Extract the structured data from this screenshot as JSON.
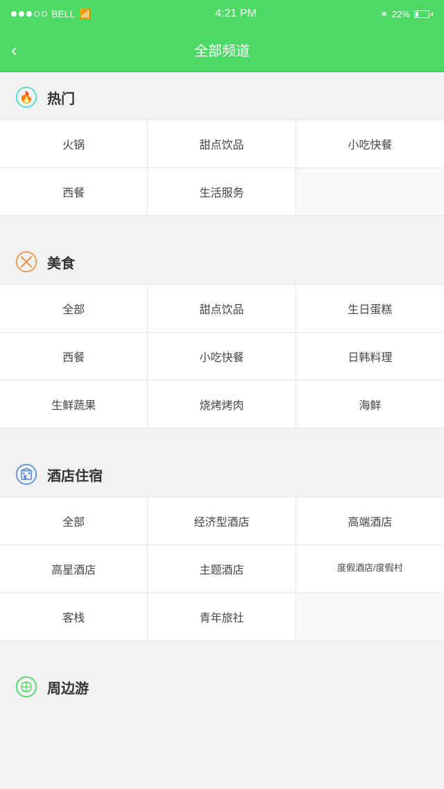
{
  "statusBar": {
    "carrier": "BELL",
    "time": "4:21 PM",
    "battery": "22%"
  },
  "header": {
    "title": "全部频道",
    "backLabel": "<"
  },
  "sections": [
    {
      "id": "hot",
      "icon": "hot-icon",
      "iconType": "hot",
      "title": "热门",
      "cols": 3,
      "items": [
        "火锅",
        "甜点饮品",
        "小吃快餐",
        "西餐",
        "生活服务"
      ]
    },
    {
      "id": "food",
      "icon": "food-icon",
      "iconType": "food",
      "title": "美食",
      "cols": 3,
      "items": [
        "全部",
        "甜点饮品",
        "生日蛋糕",
        "西餐",
        "小吃快餐",
        "日韩料理",
        "生鲜蔬果",
        "烧烤烤肉",
        "海鲜"
      ]
    },
    {
      "id": "hotel",
      "icon": "hotel-icon",
      "iconType": "hotel",
      "title": "酒店住宿",
      "cols": 3,
      "items": [
        "全部",
        "经济型酒店",
        "高端酒店",
        "高星酒店",
        "主题酒店",
        "度假酒店/度假村",
        "客栈",
        "青年旅社"
      ]
    },
    {
      "id": "travel",
      "icon": "travel-icon",
      "iconType": "travel",
      "title": "周边游",
      "cols": 3,
      "items": []
    }
  ]
}
